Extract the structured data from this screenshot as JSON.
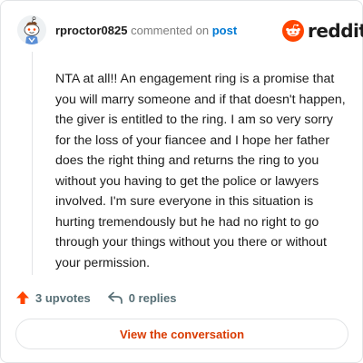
{
  "comment": {
    "username": "rproctor0825",
    "action_text": "commented on",
    "post_link_text": "post",
    "body": "NTA at all!! An engagement ring is a promise that you will marry someone and if that doesn't happen, the giver is entitled to the ring. I am so very sorry for the loss of your fiancee and I hope her father does the right thing and returns the ring to you without you having to get the police or lawyers involved. I'm sure everyone in this situation is hurting tremendously but he had no right to go through your things without you there or without your permission."
  },
  "brand": {
    "wordmark": "reddit",
    "color": "#ff4500"
  },
  "stats": {
    "upvotes_label": "3 upvotes",
    "replies_label": "0 replies",
    "upvote_icon": "upvote-arrow-icon",
    "reply_icon": "reply-arrow-icon"
  },
  "actions": {
    "view_conversation_label": "View the conversation"
  },
  "colors": {
    "link": "#0079d3",
    "button_text": "#d93a00",
    "upvote": "#ff4500",
    "muted": "#576f76"
  }
}
